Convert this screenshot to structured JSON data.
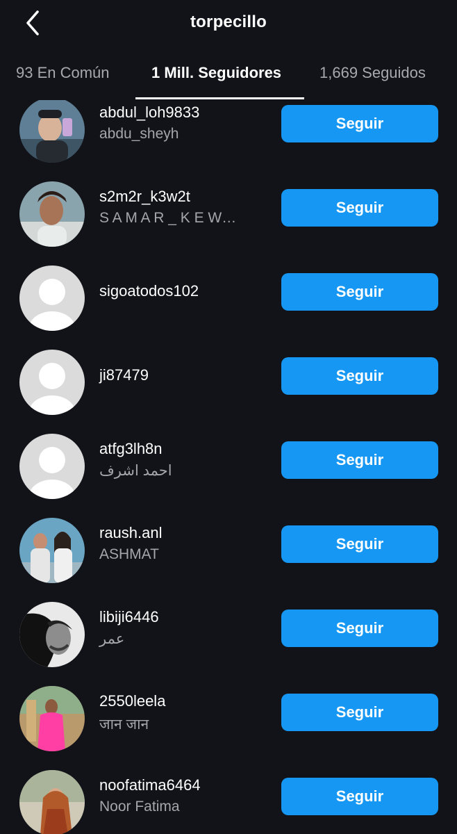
{
  "header": {
    "title": "torpecillo",
    "back_icon": "chevron-left-icon"
  },
  "tabs": [
    {
      "label": "93 En Común"
    },
    {
      "label": "1 Mill. Seguidores"
    },
    {
      "label": "1,669 Seguidos"
    }
  ],
  "colors": {
    "background": "#121318",
    "button": "#1597f3",
    "muted_text": "#a4a6ab"
  },
  "followers": [
    {
      "username": "abdul_loh9833",
      "name": "abdu_sheyh",
      "button": "Seguir",
      "avatar": "photo"
    },
    {
      "username": "s2m2r_k3w2t",
      "name": "S A M A R _ K E W…",
      "button": "Seguir",
      "avatar": "photo"
    },
    {
      "username": "sigoatodos102",
      "name": "",
      "button": "Seguir",
      "avatar": "default"
    },
    {
      "username": "ji87479",
      "name": "",
      "button": "Seguir",
      "avatar": "default"
    },
    {
      "username": "atfg3lh8n",
      "name": "احمد اشرف",
      "button": "Seguir",
      "avatar": "default"
    },
    {
      "username": "raush.anl",
      "name": "ASHMAT",
      "button": "Seguir",
      "avatar": "photo"
    },
    {
      "username": "libiji6446",
      "name": "عمر",
      "button": "Seguir",
      "avatar": "photo"
    },
    {
      "username": "2550leela",
      "name": "जान जान",
      "button": "Seguir",
      "avatar": "photo"
    },
    {
      "username": "noofatima6464",
      "name": "Noor Fatima",
      "button": "Seguir",
      "avatar": "photo"
    }
  ]
}
